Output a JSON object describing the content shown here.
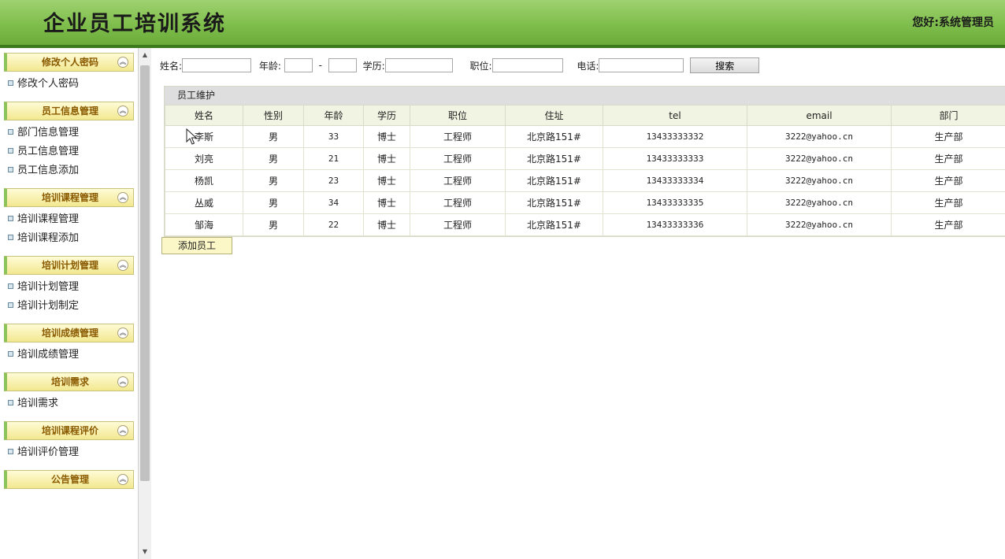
{
  "header": {
    "title": "企业员工培训系统",
    "greeting": "您好:系统管理员"
  },
  "sidebar": {
    "sections": [
      {
        "title": "修改个人密码",
        "items": [
          "修改个人密码"
        ]
      },
      {
        "title": "员工信息管理",
        "items": [
          "部门信息管理",
          "员工信息管理",
          "员工信息添加"
        ]
      },
      {
        "title": "培训课程管理",
        "items": [
          "培训课程管理",
          "培训课程添加"
        ]
      },
      {
        "title": "培训计划管理",
        "items": [
          "培训计划管理",
          "培训计划制定"
        ]
      },
      {
        "title": "培训成绩管理",
        "items": [
          "培训成绩管理"
        ]
      },
      {
        "title": "培训需求",
        "items": [
          "培训需求"
        ]
      },
      {
        "title": "培训课程评价",
        "items": [
          "培训评价管理"
        ]
      },
      {
        "title": "公告管理",
        "items": []
      }
    ]
  },
  "search": {
    "name_label": "姓名:",
    "age_label": "年龄:",
    "age_sep": "-",
    "edu_label": "学历:",
    "position_label": "职位:",
    "phone_label": "电话:",
    "search_button": "搜索"
  },
  "panel": {
    "title": "员工维护",
    "columns": [
      "姓名",
      "性别",
      "年龄",
      "学历",
      "职位",
      "住址",
      "tel",
      "email",
      "部门"
    ],
    "rows": [
      [
        "李斯",
        "男",
        "33",
        "博士",
        "工程师",
        "北京路151#",
        "13433333332",
        "3222@yahoo.cn",
        "生产部"
      ],
      [
        "刘亮",
        "男",
        "21",
        "博士",
        "工程师",
        "北京路151#",
        "13433333333",
        "3222@yahoo.cn",
        "生产部"
      ],
      [
        "杨凯",
        "男",
        "23",
        "博士",
        "工程师",
        "北京路151#",
        "13433333334",
        "3222@yahoo.cn",
        "生产部"
      ],
      [
        "丛威",
        "男",
        "34",
        "博士",
        "工程师",
        "北京路151#",
        "13433333335",
        "3222@yahoo.cn",
        "生产部"
      ],
      [
        "邹海",
        "男",
        "22",
        "博士",
        "工程师",
        "北京路151#",
        "13433333336",
        "3222@yahoo.cn",
        "生产部"
      ]
    ]
  },
  "add_button": "添加员工"
}
